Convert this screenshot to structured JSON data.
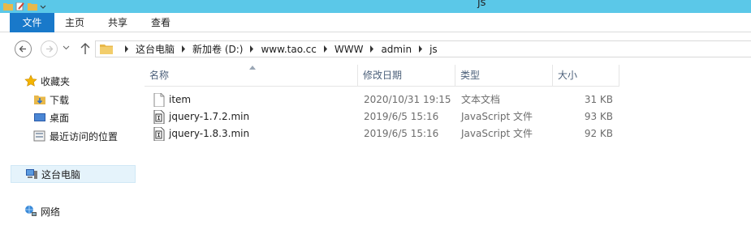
{
  "window": {
    "title": "js"
  },
  "ribbon": {
    "tabs": [
      "文件",
      "主页",
      "共享",
      "查看"
    ]
  },
  "address": {
    "crumbs": [
      "这台电脑",
      "新加卷 (D:)",
      "www.tao.cc",
      "WWW",
      "admin",
      "js"
    ]
  },
  "sidebar": {
    "favorites": "收藏夹",
    "downloads": "下载",
    "desktop": "桌面",
    "recent": "最近访问的位置",
    "this_pc": "这台电脑",
    "network": "网络"
  },
  "columns": {
    "name": "名称",
    "modified": "修改日期",
    "type": "类型",
    "size": "大小"
  },
  "files": [
    {
      "name": "item",
      "modified": "2020/10/31 19:15",
      "type": "文本文档",
      "size": "31 KB",
      "icon": "text-file-icon"
    },
    {
      "name": "jquery-1.7.2.min",
      "modified": "2019/6/5 15:16",
      "type": "JavaScript 文件",
      "size": "93 KB",
      "icon": "script-file-icon"
    },
    {
      "name": "jquery-1.8.3.min",
      "modified": "2019/6/5 15:16",
      "type": "JavaScript 文件",
      "size": "92 KB",
      "icon": "script-file-icon"
    }
  ],
  "colors": {
    "titlebar": "#5bc8e8",
    "file_tab": "#1979ca",
    "selection": "#e5f3fb",
    "header_text": "#4c607a"
  }
}
